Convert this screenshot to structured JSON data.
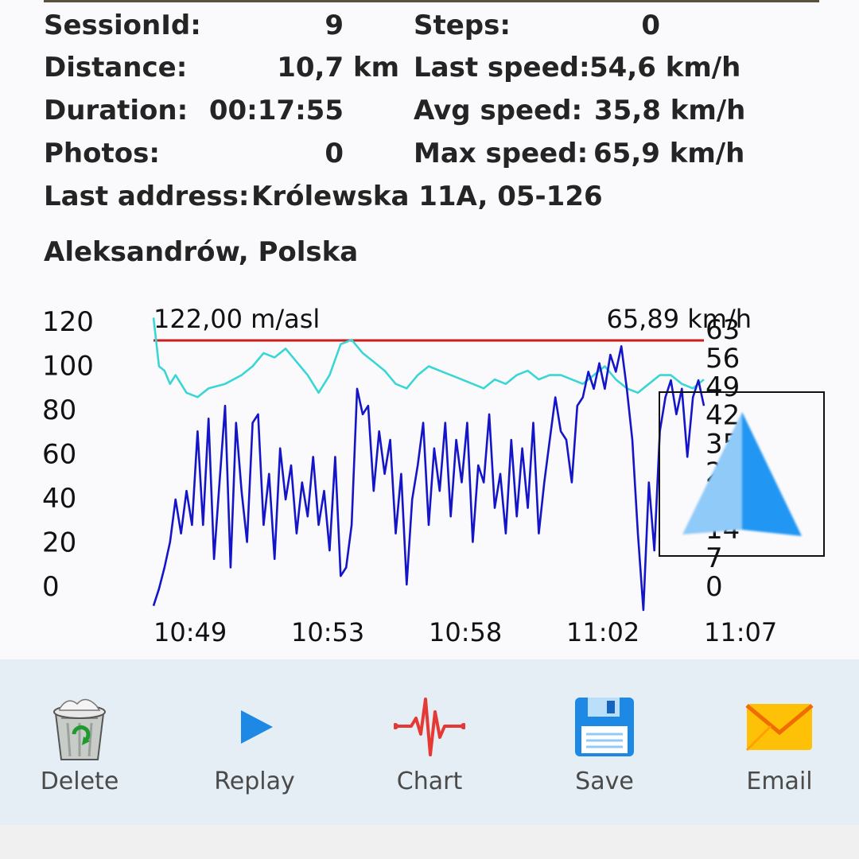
{
  "stats": {
    "session_label": "SessionId:",
    "session_value": "9",
    "steps_label": "Steps:",
    "steps_value": "0",
    "distance_label": "Distance:",
    "distance_value": "10,7 km",
    "last_speed_label": "Last speed:",
    "last_speed_value": "54,6 km/h",
    "duration_label": "Duration:",
    "duration_value": "00:17:55",
    "avg_speed_label": "Avg speed:",
    "avg_speed_value": "35,8 km/h",
    "photos_label": "Photos:",
    "photos_value": "0",
    "max_speed_label": "Max speed:",
    "max_speed_value": "65,9 km/h",
    "last_address_label": "Last address:",
    "last_address_line1": "Królewska 11A, 05-126",
    "last_address_line2": "Aleksandrów, Polska"
  },
  "chart_data": {
    "type": "line",
    "title_left": "122,00 m/asl",
    "title_right": "65,89 km/h",
    "y_left_ticks": [
      "120",
      "100",
      "80",
      "60",
      "40",
      "20",
      "0"
    ],
    "y_left_range": [
      0,
      120
    ],
    "y_right_ticks": [
      "63",
      "56",
      "49",
      "42",
      "35",
      "28",
      "21",
      "14",
      "7",
      "0"
    ],
    "y_right_range": [
      0,
      63
    ],
    "x_ticks": [
      "10:49",
      "10:53",
      "10:58",
      "11:02",
      "11:07"
    ],
    "series": [
      {
        "role": "max-altitude",
        "color": "#c81e1e",
        "x": [
          0,
          100
        ],
        "y": [
          122,
          122
        ]
      },
      {
        "role": "altitude",
        "color": "#3ad6d6",
        "x": [
          0,
          1,
          2,
          3,
          4,
          6,
          8,
          10,
          13,
          16,
          18,
          20,
          22,
          24,
          26,
          28,
          30,
          32,
          34,
          36,
          38,
          40,
          42,
          44,
          46,
          48,
          50,
          52,
          54,
          56,
          58,
          60,
          62,
          64,
          66,
          68,
          70,
          72,
          74,
          76,
          78,
          80,
          82,
          84,
          86,
          88,
          90,
          92,
          94,
          96,
          98,
          100
        ],
        "y": [
          122,
          100,
          98,
          92,
          96,
          88,
          86,
          90,
          92,
          96,
          100,
          106,
          104,
          108,
          102,
          96,
          88,
          96,
          110,
          112,
          106,
          102,
          98,
          92,
          90,
          96,
          100,
          98,
          96,
          94,
          92,
          90,
          94,
          92,
          96,
          98,
          94,
          96,
          96,
          94,
          92,
          96,
          100,
          94,
          90,
          88,
          92,
          96,
          96,
          92,
          90,
          94
        ]
      },
      {
        "role": "speed",
        "color": "#1414c8",
        "x": [
          0,
          1,
          2,
          3,
          4,
          5,
          6,
          7,
          8,
          9,
          10,
          11,
          12,
          13,
          14,
          15,
          16,
          17,
          18,
          19,
          20,
          21,
          22,
          23,
          24,
          25,
          26,
          27,
          28,
          29,
          30,
          31,
          32,
          33,
          34,
          35,
          36,
          37,
          38,
          39,
          40,
          41,
          42,
          43,
          44,
          45,
          46,
          47,
          48,
          49,
          50,
          51,
          52,
          53,
          54,
          55,
          56,
          57,
          58,
          59,
          60,
          61,
          62,
          63,
          64,
          65,
          66,
          67,
          68,
          69,
          70,
          71,
          72,
          73,
          74,
          75,
          76,
          77,
          78,
          79,
          80,
          81,
          82,
          83,
          84,
          85,
          86,
          87,
          88,
          89,
          90,
          91,
          92,
          93,
          94,
          95,
          96,
          97,
          98,
          99,
          100
        ],
        "y": [
          1,
          5,
          10,
          16,
          26,
          18,
          28,
          20,
          42,
          20,
          45,
          12,
          30,
          48,
          10,
          44,
          28,
          16,
          44,
          46,
          20,
          32,
          12,
          38,
          26,
          34,
          18,
          30,
          22,
          36,
          20,
          28,
          14,
          36,
          8,
          10,
          20,
          52,
          46,
          48,
          28,
          42,
          32,
          40,
          18,
          32,
          6,
          26,
          34,
          44,
          20,
          38,
          28,
          44,
          22,
          40,
          30,
          44,
          16,
          34,
          30,
          46,
          24,
          32,
          18,
          40,
          22,
          38,
          24,
          44,
          18,
          30,
          40,
          50,
          42,
          40,
          30,
          48,
          50,
          56,
          52,
          58,
          52,
          60,
          56,
          62,
          52,
          40,
          18,
          0,
          30,
          14,
          42,
          50,
          54,
          46,
          52,
          36,
          50,
          54,
          48
        ]
      }
    ]
  },
  "toolbar": {
    "delete_label": "Delete",
    "delete_icon": "recycle-bin-icon",
    "replay_label": "Replay",
    "replay_icon": "play-icon",
    "chart_label": "Chart",
    "chart_icon": "pulse-chart-icon",
    "save_label": "Save",
    "save_icon": "floppy-disk-icon",
    "email_label": "Email",
    "email_icon": "envelope-icon"
  },
  "map_pointer": {
    "icon": "navigation-arrow-icon",
    "colors": [
      "#90caf9",
      "#2196f3"
    ]
  }
}
